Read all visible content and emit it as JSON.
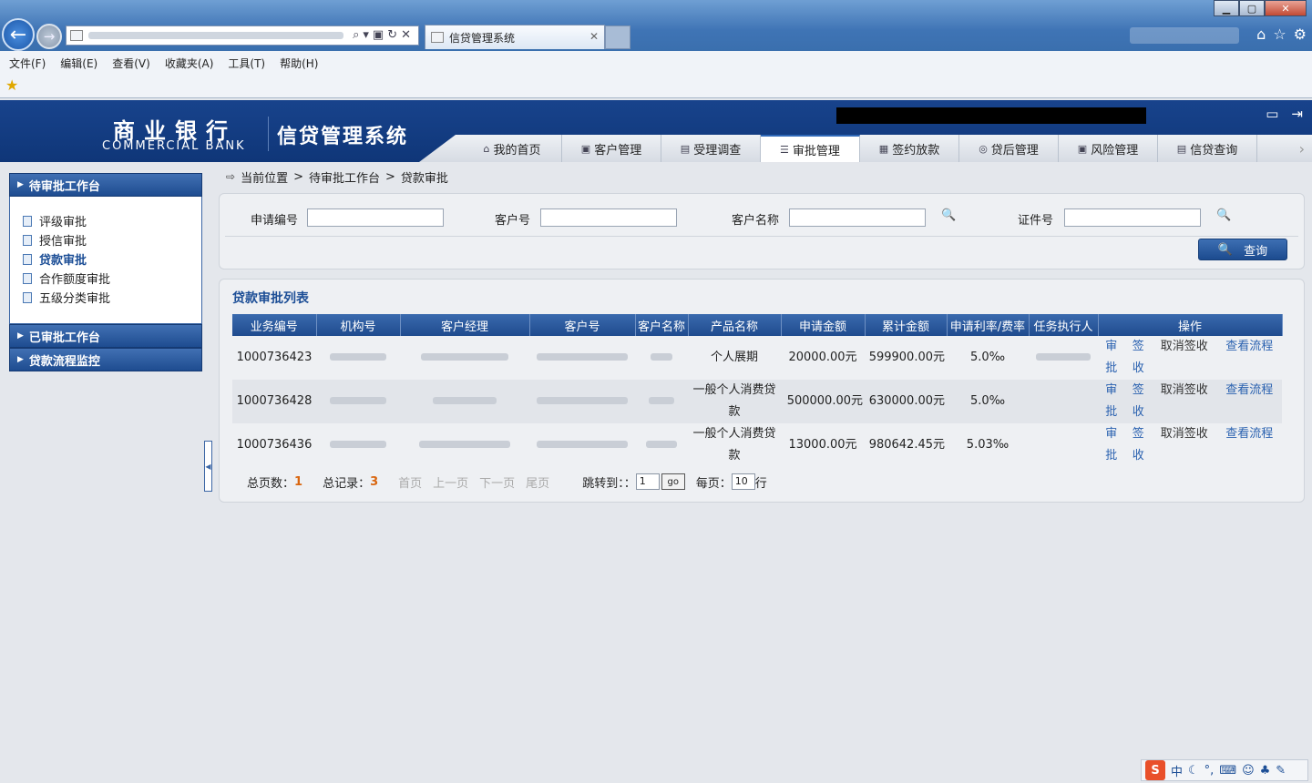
{
  "browser": {
    "tab_title": "信贷管理系统",
    "menu": [
      "文件(F)",
      "编辑(E)",
      "查看(V)",
      "收藏夹(A)",
      "工具(T)",
      "帮助(H)"
    ]
  },
  "header": {
    "bank_cn": "商业银行",
    "bank_en": "COMMERCIAL BANK",
    "system_name": "信贷管理系统",
    "tabs": [
      "我的首页",
      "客户管理",
      "受理调查",
      "审批管理",
      "签约放款",
      "贷后管理",
      "风险管理",
      "信贷查询"
    ],
    "active_tab": 3
  },
  "sidebar": {
    "sections": [
      {
        "title": "待审批工作台",
        "items": [
          "评级审批",
          "授信审批",
          "贷款审批",
          "合作额度审批",
          "五级分类审批"
        ],
        "active_item": 2
      },
      {
        "title": "已审批工作台"
      },
      {
        "title": "贷款流程监控"
      }
    ]
  },
  "breadcrumb": {
    "prefix": "当前位置",
    "path": [
      "待审批工作台",
      "贷款审批"
    ],
    "sep": ">"
  },
  "search": {
    "fields": [
      "申请编号",
      "客户号",
      "客户名称",
      "证件号"
    ],
    "query_label": "查询"
  },
  "list": {
    "title": "贷款审批列表",
    "columns": [
      "业务编号",
      "机构号",
      "客户经理",
      "客户号",
      "客户名称",
      "产品名称",
      "申请金额",
      "累计金额",
      "申请利率/费率",
      "任务执行人",
      "操作"
    ],
    "rows": [
      {
        "id": "1000736423",
        "product": "个人展期",
        "amount": "20000.00元",
        "total": "599900.00元",
        "rate": "5.0‰"
      },
      {
        "id": "1000736428",
        "product": "一般个人消费贷款",
        "amount": "500000.00元",
        "total": "630000.00元",
        "rate": "5.0‰"
      },
      {
        "id": "1000736436",
        "product": "一般个人消费贷款",
        "amount": "13000.00元",
        "total": "980642.45元",
        "rate": "5.03‰"
      }
    ],
    "ops": {
      "approve": "审批",
      "sign": "签收",
      "cancel": "取消签收",
      "flow": "查看流程"
    }
  },
  "pager": {
    "pages_label": "总页数：",
    "pages": "1",
    "records_label": "总记录：",
    "records": "3",
    "first": "首页",
    "prev": "上一页",
    "next": "下一页",
    "last": "尾页",
    "jump_label": "跳转到：：",
    "jump_value": "1",
    "go": "go",
    "per_page_label": "每页：",
    "per_page": "10",
    "rows_label": "行"
  },
  "tray": {
    "ime": "中"
  }
}
